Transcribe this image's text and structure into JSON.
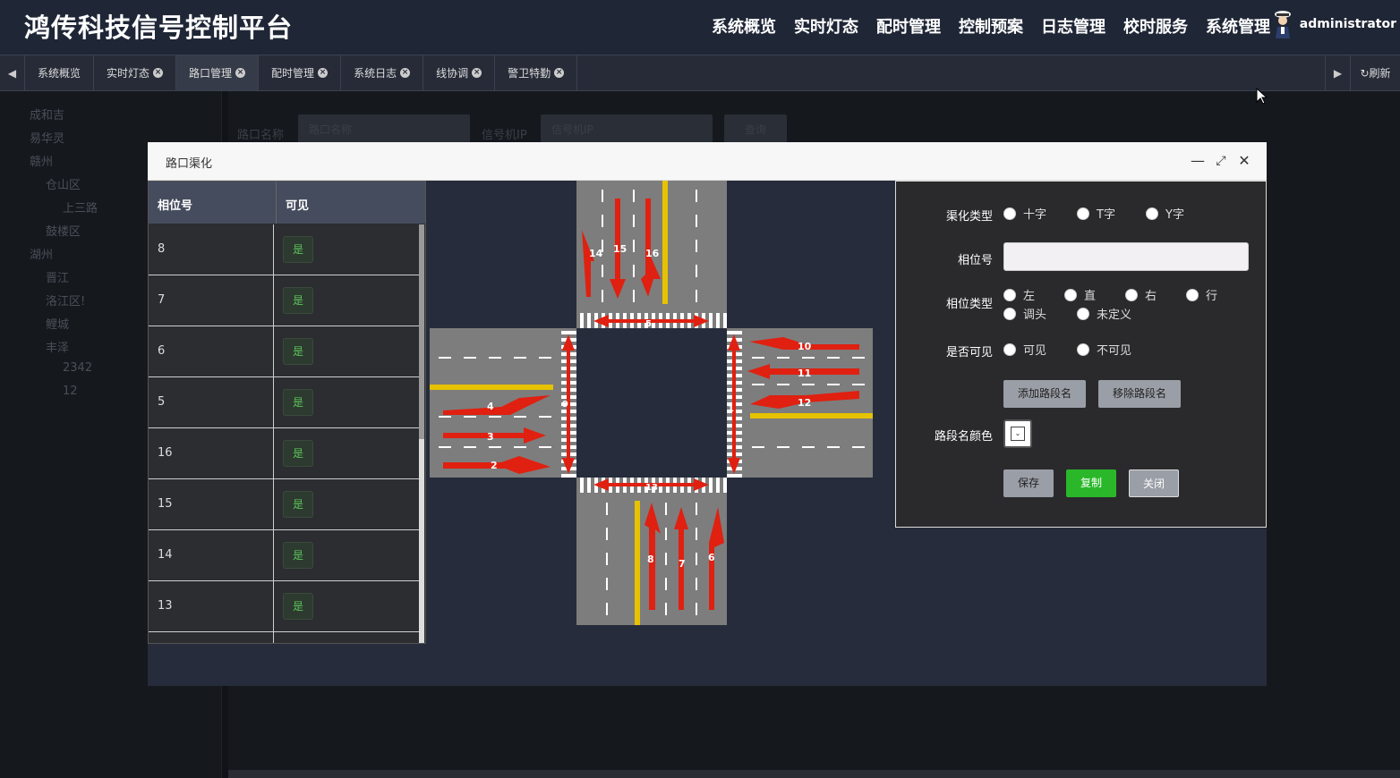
{
  "app": {
    "title": "鸿传科技信号控制平台",
    "user": "administrator"
  },
  "nav": [
    "系统概览",
    "实时灯态",
    "配时管理",
    "控制预案",
    "日志管理",
    "校时服务",
    "系统管理"
  ],
  "tabs": [
    {
      "label": "系统概览",
      "closable": false
    },
    {
      "label": "实时灯态",
      "closable": true
    },
    {
      "label": "路口管理",
      "closable": true,
      "active": true
    },
    {
      "label": "配时管理",
      "closable": true
    },
    {
      "label": "系统日志",
      "closable": true
    },
    {
      "label": "线协调",
      "closable": true
    },
    {
      "label": "警卫特勤",
      "closable": true
    }
  ],
  "refresh_label": "刷新",
  "sidebar": [
    "成和吉",
    "易华灵",
    "赣州",
    "仓山区",
    "上三路",
    "鼓楼区",
    "湖州",
    "晋江",
    "洛江区!",
    "鲤城",
    "丰泽",
    "2342",
    "12"
  ],
  "search": {
    "name_label": "路口名称",
    "name_placeholder": "路口名称",
    "ip_label": "信号机IP",
    "ip_placeholder": "信号机IP",
    "button": "查询"
  },
  "modal": {
    "title": "路口渠化"
  },
  "table": {
    "headers": [
      "相位号",
      "可见"
    ],
    "rows": [
      {
        "phase": "8",
        "visible": "是"
      },
      {
        "phase": "7",
        "visible": "是"
      },
      {
        "phase": "6",
        "visible": "是"
      },
      {
        "phase": "5",
        "visible": "是"
      },
      {
        "phase": "16",
        "visible": "是"
      },
      {
        "phase": "15",
        "visible": "是"
      },
      {
        "phase": "14",
        "visible": "是"
      },
      {
        "phase": "13",
        "visible": "是"
      }
    ]
  },
  "intersection": {
    "phase_labels": [
      "14",
      "15",
      "16",
      "5",
      "10",
      "11",
      "12",
      "4",
      "3",
      "2",
      "9",
      "1",
      "13",
      "8",
      "7",
      "6"
    ]
  },
  "form": {
    "type_label": "渠化类型",
    "types": [
      "十字",
      "T字",
      "Y字"
    ],
    "phase_label": "相位号",
    "phase_type_label": "相位类型",
    "phase_types": [
      "左",
      "直",
      "右",
      "行",
      "调头",
      "未定义"
    ],
    "visible_label": "是否可见",
    "visible_options": [
      "可见",
      "不可见"
    ],
    "add_road_btn": "添加路段名",
    "remove_road_btn": "移除路段名",
    "color_label": "路段名颜色",
    "save_btn": "保存",
    "copy_btn": "复制",
    "close_btn": "关闭"
  }
}
